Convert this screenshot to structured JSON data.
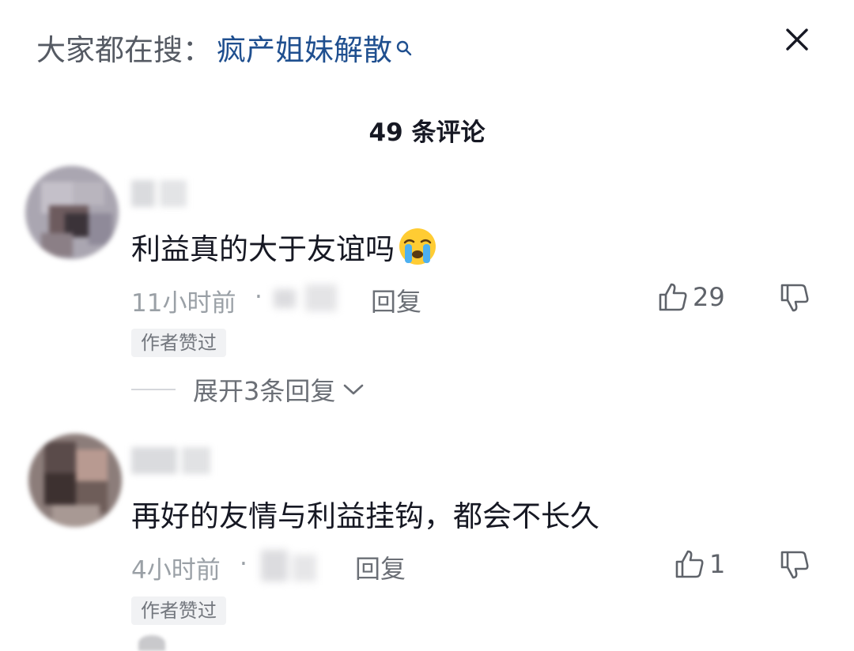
{
  "search": {
    "prefix": "大家都在搜：",
    "keyword": "疯产姐妹解散",
    "icon": "search-icon"
  },
  "header": {
    "comment_count": "49 条评论",
    "close_icon": "close-icon"
  },
  "comments": [
    {
      "text": "利益真的大于友谊吗",
      "emoji": "crying-face-emoji",
      "time": "11小时前",
      "separator": "·",
      "reply_label": "回复",
      "likes": "29",
      "badge": "作者赞过",
      "expand_label": "展开3条回复"
    },
    {
      "text": "再好的友情与利益挂钩，都会不长久",
      "time": "4小时前",
      "separator": "·",
      "reply_label": "回复",
      "likes": "1",
      "badge": "作者赞过"
    }
  ],
  "colors": {
    "keyword": "#1f4f8f",
    "text_primary": "#161823",
    "text_secondary": "#9aa0a6",
    "badge_bg": "#f1f2f4"
  }
}
